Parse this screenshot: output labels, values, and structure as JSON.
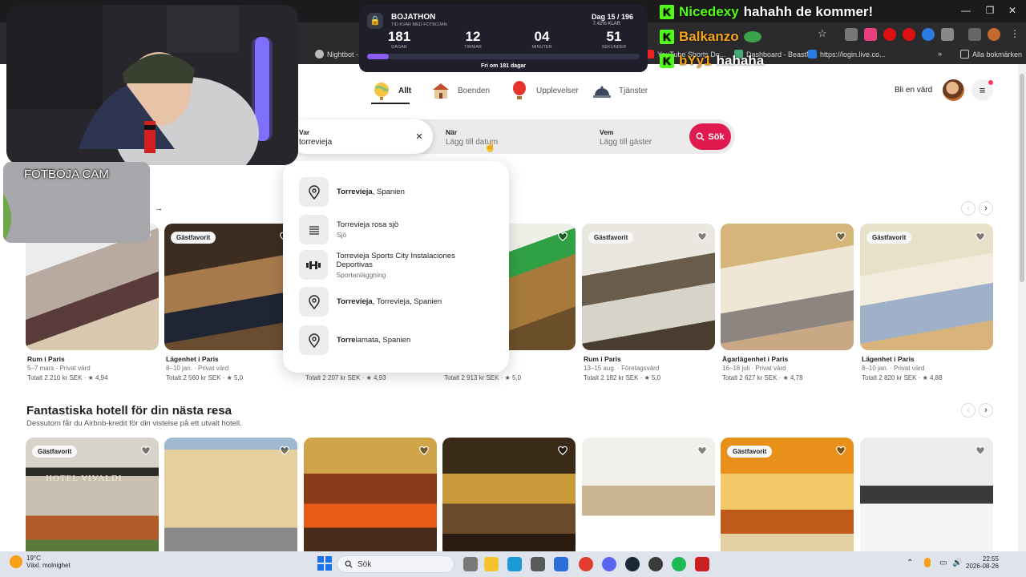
{
  "browser": {
    "bookmarks": [
      {
        "label": "Nightbot -"
      },
      {
        "label": "YouTube Shorts Do..."
      },
      {
        "label": "Dashboard - BeastN..."
      },
      {
        "label": "https://login.live.co..."
      },
      {
        "label": "Alla bokmärken"
      }
    ]
  },
  "nav": {
    "tabs": [
      {
        "label": "Allt"
      },
      {
        "label": "Boenden"
      },
      {
        "label": "Upplevelser"
      },
      {
        "label": "Tjänster"
      }
    ],
    "host_label": "Bli en värd"
  },
  "search": {
    "where_label": "Var",
    "where_value": "torrevieja",
    "when_label": "När",
    "when_placeholder": "Lägg till datum",
    "who_label": "Vem",
    "who_placeholder": "Lägg till gäster",
    "button_label": "Sök",
    "suggestions": [
      {
        "bold": "Torrevieja",
        "rest": ", Spanien",
        "sub": ""
      },
      {
        "bold": "",
        "rest": "Torrevieja rosa sjö",
        "sub": "Sjö"
      },
      {
        "bold": "",
        "rest": "Torrevieja Sports City Instalaciones Deportivas",
        "sub": "Sportanläggning"
      },
      {
        "bold": "Torrevieja",
        "rest": ", Torrevieja, Spanien",
        "sub": ""
      },
      {
        "bold": "Torre",
        "rest": "lamata, Spanien",
        "sub": ""
      }
    ]
  },
  "section1": {
    "badge": "Gästfavorit",
    "cards": [
      {
        "title": "Rum i Paris",
        "dates": "5–7 mars · Privat värd",
        "price": "Totalt 2 210 kr SEK · ★ 4,94"
      },
      {
        "title": "Lägenhet i Paris",
        "dates": "8–10 jan. · Privat värd",
        "price": "Totalt 2 560 kr SEK · ★ 5,0"
      },
      {
        "title": "",
        "dates": "",
        "price": "Totalt 2 207 kr SEK · ★ 4,93"
      },
      {
        "title": "",
        "dates": "",
        "price": "Totalt 2 913 kr SEK · ★ 5,0"
      },
      {
        "title": "Rum i Paris",
        "dates": "13–15 aug. · Företagsvärd",
        "price": "Totalt 2 182 kr SEK · ★ 5,0"
      },
      {
        "title": "Ägarlägenhet i Paris",
        "dates": "16–18 juli · Privat värd",
        "price": "Totalt 2 627 kr SEK · ★ 4,78"
      },
      {
        "title": "Lägenhet i Paris",
        "dates": "8–10 jan. · Privat värd",
        "price": "Totalt 2 820 kr SEK · ★ 4,88"
      }
    ]
  },
  "section2": {
    "title": "Fantastiska hotell för din nästa resa",
    "subtitle": "Dessutom får du Airbnb-kredit för din vistelse på ett utvalt hotell.",
    "badge": "Gästfavorit",
    "hotel_sign": "HOTEL VIVALDI"
  },
  "overlay": {
    "cam_label": "FOTBOJA CAM",
    "timer": {
      "title": "BOJATHON",
      "subtitle": "TID KVAR MED FOTBOJAN",
      "day": "Dag 15 / 196",
      "pct": "7.42% KLAR",
      "units": [
        {
          "v": "181",
          "l": "DAGAR"
        },
        {
          "v": "12",
          "l": "TIMMAR"
        },
        {
          "v": "04",
          "l": "MINUTER"
        },
        {
          "v": "51",
          "l": "SEKUNDER"
        }
      ],
      "progress": 0.0742,
      "footer": "Fri om 181 dagar"
    },
    "chat": [
      {
        "user": "Nicedexy",
        "msg": "hahahh de kommer!",
        "color": "#53fc18"
      },
      {
        "user": "Balkanzo",
        "msg": "",
        "color": "#f7a41d"
      },
      {
        "user": "bYy1",
        "msg": "hahaha",
        "color": "#f7a41d"
      }
    ]
  },
  "taskbar": {
    "temp": "19°C",
    "weather": "Växl. molnighet",
    "search": "Sök",
    "time": "22:55",
    "date": "2026-08-26"
  }
}
